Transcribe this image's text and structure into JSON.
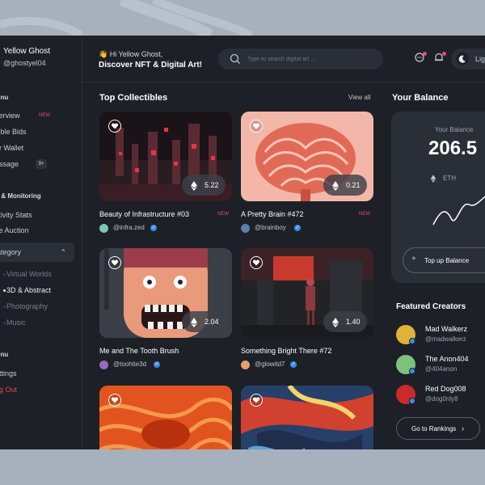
{
  "profile": {
    "name": "Yellow Ghost",
    "handle": "@ghostyel04"
  },
  "sidebar": {
    "menu_head": "enu",
    "items": [
      {
        "label": "verview",
        "badge": "NEW"
      },
      {
        "label": "sible Bids"
      },
      {
        "label": "ur Wallet"
      },
      {
        "label": "essage",
        "badge": "9+"
      }
    ],
    "monitor_head": "r & Monitoring",
    "monitor_items": [
      {
        "label": "ctivity Stats"
      },
      {
        "label": "ve Auction"
      }
    ],
    "category": {
      "label": "ategory"
    },
    "sub_items": [
      "Virtual Worlds",
      "3D & Abstract",
      "Photography",
      "Music"
    ],
    "menu2_head": "enu",
    "settings": "ettings",
    "logout": "og Out"
  },
  "topbar": {
    "greeting": "👋 Hi Yellow Ghost,",
    "subtitle": "Discover NFT & Digital Art!",
    "search_placeholder": "Type to search digital art ...",
    "theme_label": "Lig"
  },
  "collectibles": {
    "title": "Top Collectibles",
    "view_all": "View all",
    "cards": [
      {
        "title": "Beauty of Infrastructure #03",
        "price": "5.22",
        "new": "NEW",
        "creator": "@infra.zed"
      },
      {
        "title": "A Pretty Brain #472",
        "price": "0.21",
        "new": "NEW",
        "creator": "@brainboy"
      },
      {
        "title": "Me and The Tooth Brush",
        "price": "2.04",
        "creator": "@toohtie3d"
      },
      {
        "title": "Something Bright There #72",
        "price": "1.40",
        "creator": "@glowitd7"
      },
      {
        "title": "",
        "price": ""
      },
      {
        "title": "",
        "price": ""
      }
    ]
  },
  "balance": {
    "title": "Your Balance",
    "label": "Your Balance",
    "amount": "206.5",
    "currency": "ETH",
    "topup": "Top up Balance"
  },
  "featured": {
    "title": "Featured Creators",
    "creators": [
      {
        "name": "Mad Walkerz",
        "handle": "@madwalkerz"
      },
      {
        "name": "The Anon404",
        "handle": "@404anon"
      },
      {
        "name": "Red Dog008",
        "handle": "@dog0nly8"
      }
    ],
    "rankings": "Go to Rankings"
  },
  "colors": {
    "accent_red": "#e84b6b",
    "verified_blue": "#3a8de8",
    "panel": "#1d2027",
    "card": "#2a2e37"
  }
}
